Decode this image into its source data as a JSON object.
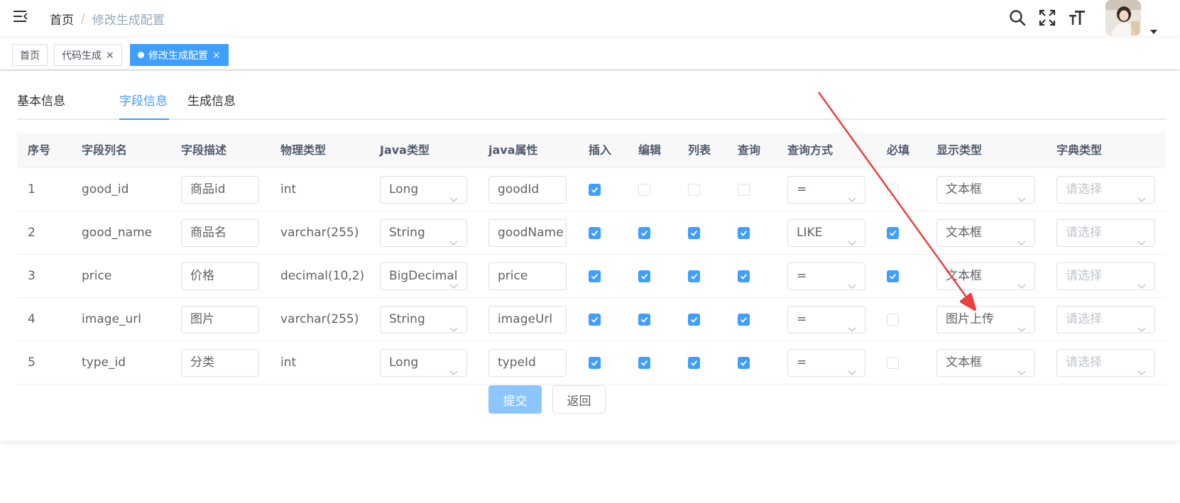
{
  "navbar": {
    "breadcrumb_home": "首页",
    "breadcrumb_sep": "/",
    "breadcrumb_current": "修改生成配置",
    "icons": [
      "menu-fold-icon",
      "search-icon",
      "fullscreen-icon",
      "font-size-icon",
      "avatar",
      "caret-down-icon"
    ]
  },
  "tags": [
    {
      "label": "首页",
      "active": false
    },
    {
      "label": "代码生成",
      "active": false,
      "close": "×"
    },
    {
      "label": "修改生成配置",
      "active": true,
      "close": "×"
    }
  ],
  "tabs": [
    {
      "label": "基本信息",
      "active": false
    },
    {
      "label": "字段信息",
      "active": true
    },
    {
      "label": "生成信息",
      "active": false
    }
  ],
  "table": {
    "headers": [
      "序号",
      "字段列名",
      "字段描述",
      "物理类型",
      "Java类型",
      "java属性",
      "插入",
      "编辑",
      "列表",
      "查询",
      "查询方式",
      "必填",
      "显示类型",
      "字典类型"
    ],
    "rows": [
      {
        "index": "1",
        "column": "good_id",
        "desc": "商品id",
        "physical": "int",
        "java_type": "Long",
        "java_field": "goodId",
        "insert": true,
        "edit": false,
        "list": false,
        "query": false,
        "query_type": "=",
        "required": false,
        "html_type": "文本框",
        "dict_type": "请选择"
      },
      {
        "index": "2",
        "column": "good_name",
        "desc": "商品名",
        "physical": "varchar(255)",
        "java_type": "String",
        "java_field": "goodName",
        "insert": true,
        "edit": true,
        "list": true,
        "query": true,
        "query_type": "LIKE",
        "required": true,
        "html_type": "文本框",
        "dict_type": "请选择"
      },
      {
        "index": "3",
        "column": "price",
        "desc": "价格",
        "physical": "decimal(10,2)",
        "java_type": "BigDecimal",
        "java_field": "price",
        "insert": true,
        "edit": true,
        "list": true,
        "query": true,
        "query_type": "=",
        "required": true,
        "html_type": "文本框",
        "dict_type": "请选择"
      },
      {
        "index": "4",
        "column": "image_url",
        "desc": "图片",
        "physical": "varchar(255)",
        "java_type": "String",
        "java_field": "imageUrl",
        "insert": true,
        "edit": true,
        "list": true,
        "query": true,
        "query_type": "=",
        "required": false,
        "html_type": "图片上传",
        "dict_type": "请选择"
      },
      {
        "index": "5",
        "column": "type_id",
        "desc": "分类",
        "physical": "int",
        "java_type": "Long",
        "java_field": "typeId",
        "insert": true,
        "edit": true,
        "list": true,
        "query": true,
        "query_type": "=",
        "required": false,
        "html_type": "文本框",
        "dict_type": "请选择"
      }
    ]
  },
  "buttons": {
    "submit": "提交",
    "back": "返回"
  },
  "colors": {
    "primary": "#409eff",
    "primary_disabled": "#8cc5ff",
    "annotation_arrow": "#e8413e"
  }
}
